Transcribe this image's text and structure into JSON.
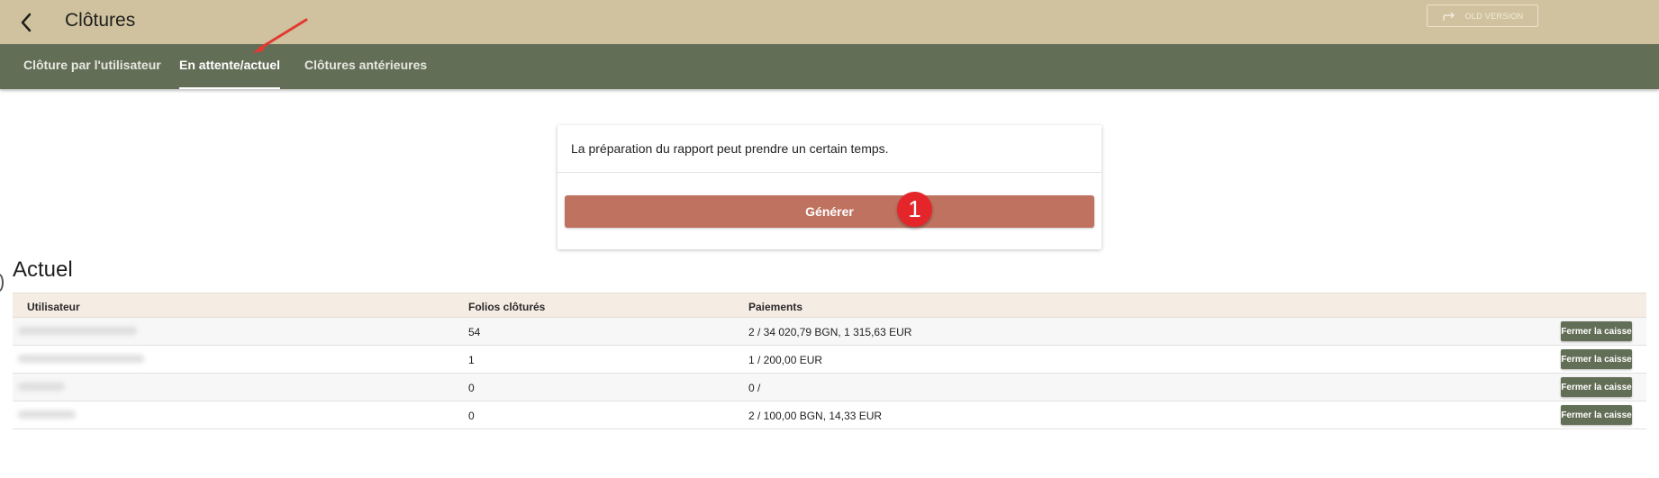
{
  "header": {
    "title": "Clôtures",
    "old_version_label": "OLD VERSION"
  },
  "tabs": [
    {
      "label": "Clôture par l'utilisateur",
      "active": false
    },
    {
      "label": "En attente/actuel",
      "active": true
    },
    {
      "label": "Clôtures antérieures",
      "active": false
    }
  ],
  "report": {
    "message": "La préparation du rapport peut prendre un certain temps.",
    "generate_label": "Générer",
    "annotation_badge": "1"
  },
  "current": {
    "title": "Actuel",
    "columns": [
      "Utilisateur",
      "Folios clôturés",
      "Paiements"
    ],
    "rows": [
      {
        "user": "",
        "folios": "54",
        "payments": "2 / 34 020,79 BGN, 1 315,63 EUR",
        "action": "Fermer la caisse"
      },
      {
        "user": "",
        "folios": "1",
        "payments": "1 / 200,00 EUR",
        "action": "Fermer la caisse"
      },
      {
        "user": "",
        "folios": "0",
        "payments": "0 /",
        "action": "Fermer la caisse"
      },
      {
        "user": "",
        "folios": "0",
        "payments": "2 / 100,00 BGN, 14,33 EUR",
        "action": "Fermer la caisse"
      }
    ]
  },
  "colors": {
    "header_bg": "#d0c29e",
    "tabbar_bg": "#636e57",
    "generate_button": "#bf7260",
    "annotation": "#e4262b",
    "table_header_bg": "#f5ece4"
  }
}
